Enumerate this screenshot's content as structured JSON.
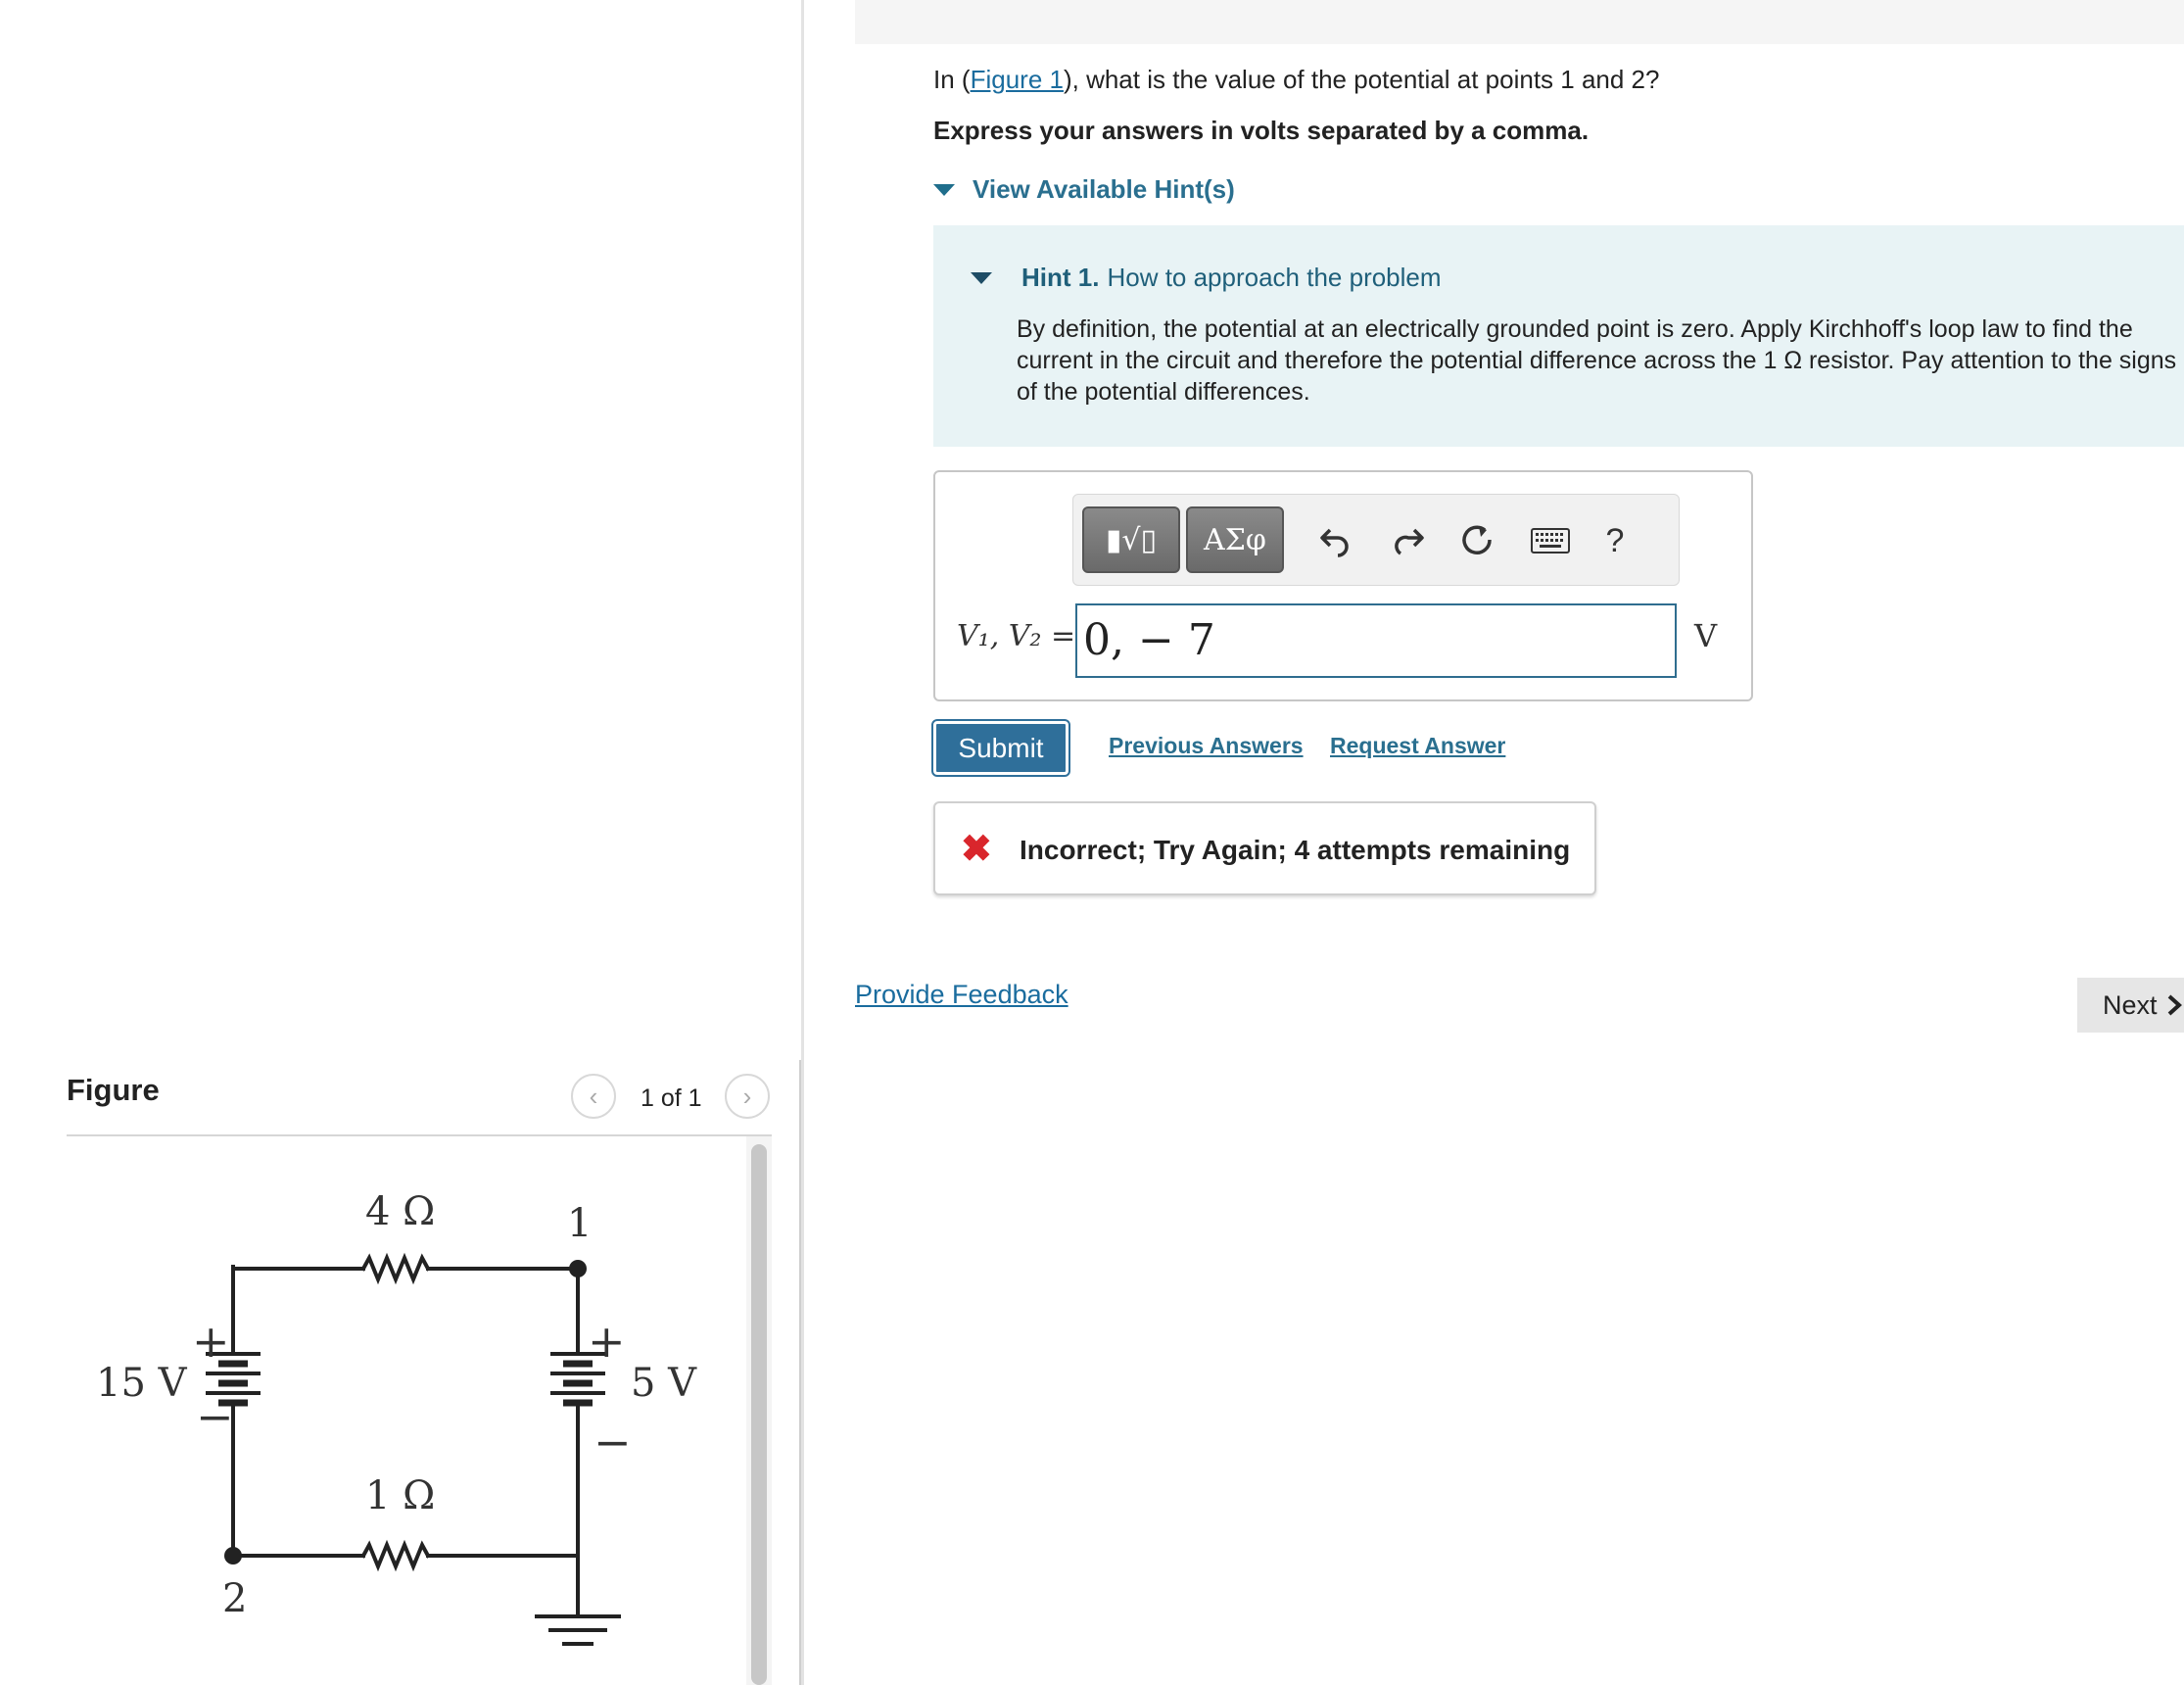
{
  "question": {
    "prefix": "In (",
    "figure_link": "Figure 1",
    "suffix": "), what is the value of the potential at points 1 and 2?",
    "instruction": "Express your answers in volts separated by a comma."
  },
  "hints": {
    "toggle_label": "View Available Hint(s)",
    "hint1_number": "Hint 1.",
    "hint1_title": "How to approach the problem",
    "hint1_body": "By definition, the potential at an electrically grounded point is zero. Apply Kirchhoff's loop law to find the current in the circuit and therefore the potential difference across the 1 Ω resistor. Pay attention to the signs of the potential differences."
  },
  "answer": {
    "toolbar": {
      "templates_label": "▮√▯",
      "greek_label": "ΑΣφ",
      "undo_icon": "undo-icon",
      "redo_icon": "redo-icon",
      "reset_icon": "reset-icon",
      "keyboard_icon": "keyboard-icon",
      "help_label": "?"
    },
    "label": "V₁, V₂ =",
    "value": "0, − 7",
    "unit": "V"
  },
  "actions": {
    "submit": "Submit",
    "previous_answers": "Previous Answers",
    "request_answer": "Request Answer"
  },
  "feedback": {
    "message": "Incorrect; Try Again; 4 attempts remaining",
    "status_color": "#d9262c"
  },
  "footer": {
    "provide_feedback": "Provide Feedback",
    "next": "Next"
  },
  "figure": {
    "title": "Figure",
    "page_indicator": "1 of 1",
    "labels": {
      "r_top": "4 Ω",
      "r_bottom": "1 Ω",
      "v_left": "15 V",
      "v_right": "5 V",
      "point1": "1",
      "point2": "2",
      "plus": "+",
      "minus": "−"
    }
  },
  "colors": {
    "accent": "#2f6f9a",
    "link": "#1a6c9e",
    "hint_bg": "#e8f3f5"
  }
}
